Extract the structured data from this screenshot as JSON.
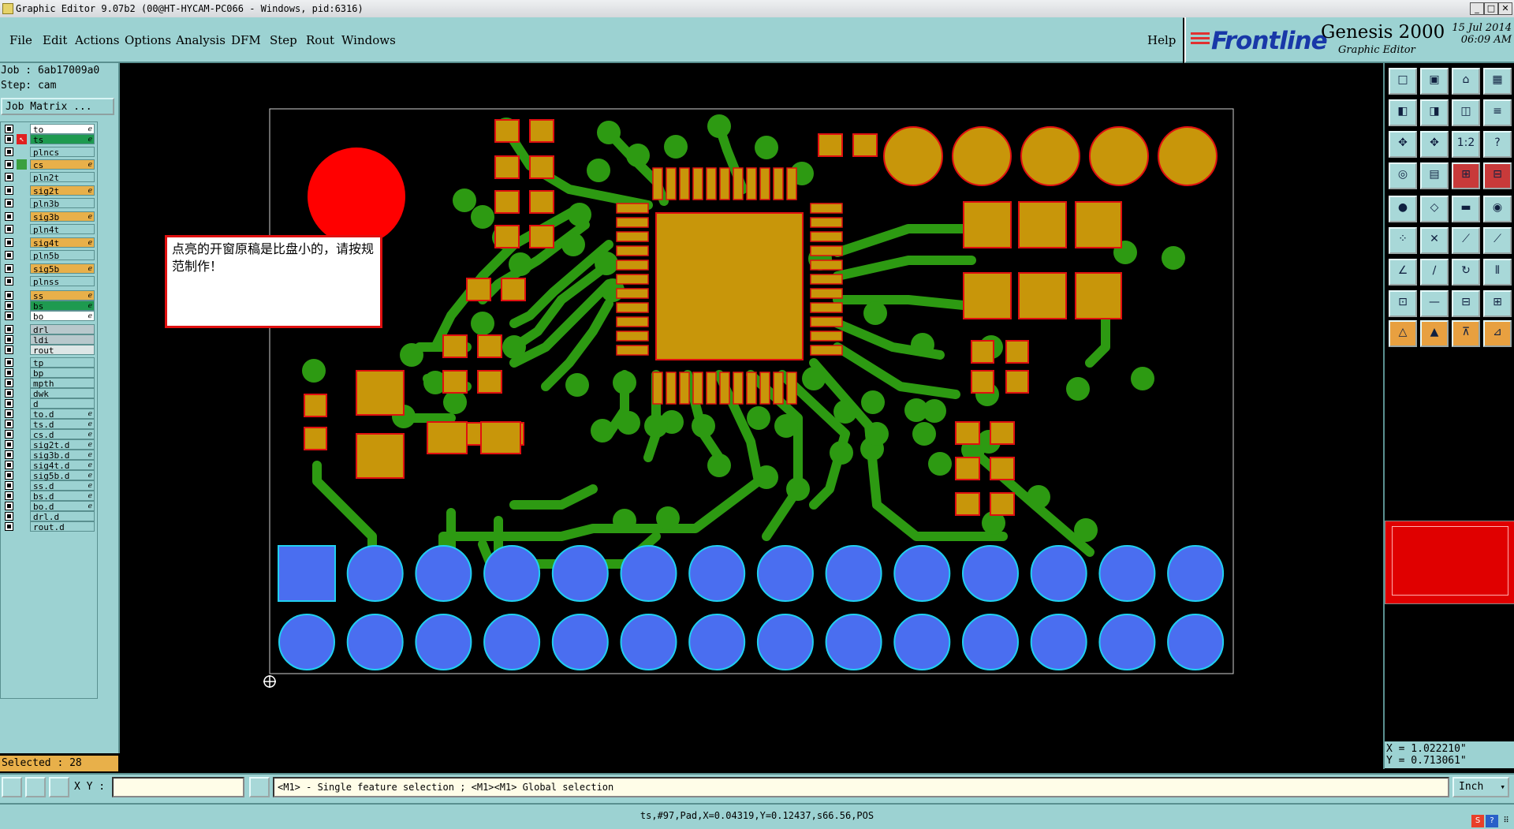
{
  "window": {
    "title": "Graphic Editor 9.07b2 (00@HT-HYCAM-PC066 - Windows, pid:6316)",
    "buttons": [
      "_",
      "□",
      "✕"
    ]
  },
  "menu": {
    "items": [
      "File",
      "Edit",
      "Actions",
      "Options",
      "Analysis",
      "DFM",
      "Step",
      "Rout",
      "Windows"
    ],
    "help": "Help"
  },
  "brand": {
    "logo": "Frontline",
    "product": "Genesis 2000",
    "subtitle": "Graphic Editor",
    "date": "15 Jul 2014",
    "time": "06:09 AM"
  },
  "left": {
    "job": "Job : 6ab17009a0",
    "step": "Step: cam",
    "job_matrix": "Job Matrix ...",
    "layers": [
      {
        "name": "to",
        "color": "#ffffff",
        "flag": "ℯ"
      },
      {
        "name": "ts",
        "color": "#1e9a50",
        "flag": "ℯ",
        "active": true
      },
      {
        "name": "plncs",
        "color": "#9cd2d2",
        "flag": ""
      },
      {
        "name": "cs",
        "color": "#e8b04a",
        "flag": "ℯ",
        "mark": "#3aa040"
      },
      {
        "name": "pln2t",
        "color": "#9cd2d2",
        "flag": ""
      },
      {
        "name": "sig2t",
        "color": "#e8b04a",
        "flag": "ℯ"
      },
      {
        "name": "pln3b",
        "color": "#9cd2d2",
        "flag": ""
      },
      {
        "name": "sig3b",
        "color": "#e8b04a",
        "flag": "ℯ"
      },
      {
        "name": "pln4t",
        "color": "#9cd2d2",
        "flag": ""
      },
      {
        "name": "sig4t",
        "color": "#e8b04a",
        "flag": "ℯ"
      },
      {
        "name": "pln5b",
        "color": "#9cd2d2",
        "flag": ""
      },
      {
        "name": "sig5b",
        "color": "#e8b04a",
        "flag": "ℯ"
      },
      {
        "name": "plnss",
        "color": "#9cd2d2",
        "flag": ""
      },
      {
        "name": "ss",
        "color": "#e8b04a",
        "flag": "ℯ"
      },
      {
        "name": "bs",
        "color": "#1e9a50",
        "flag": "ℯ"
      },
      {
        "name": "bo",
        "color": "#ffffff",
        "flag": "ℯ"
      },
      {
        "name": "drl",
        "color": "#b8c8cc",
        "flag": ""
      },
      {
        "name": "ldi",
        "color": "#b8c8cc",
        "flag": ""
      },
      {
        "name": "rout",
        "color": "#dde6e6",
        "flag": ""
      },
      {
        "name": "tp",
        "color": "#9cd2d2",
        "flag": ""
      },
      {
        "name": "bp",
        "color": "#9cd2d2",
        "flag": ""
      },
      {
        "name": "mpth",
        "color": "#9cd2d2",
        "flag": ""
      },
      {
        "name": "dwk",
        "color": "#9cd2d2",
        "flag": ""
      },
      {
        "name": "d",
        "color": "#9cd2d2",
        "flag": ""
      },
      {
        "name": "to.d",
        "color": "#9cd2d2",
        "flag": "ℯ"
      },
      {
        "name": "ts.d",
        "color": "#9cd2d2",
        "flag": "ℯ"
      },
      {
        "name": "cs.d",
        "color": "#9cd2d2",
        "flag": "ℯ"
      },
      {
        "name": "sig2t.d",
        "color": "#9cd2d2",
        "flag": "ℯ"
      },
      {
        "name": "sig3b.d",
        "color": "#9cd2d2",
        "flag": "ℯ"
      },
      {
        "name": "sig4t.d",
        "color": "#9cd2d2",
        "flag": "ℯ"
      },
      {
        "name": "sig5b.d",
        "color": "#9cd2d2",
        "flag": "ℯ"
      },
      {
        "name": "ss.d",
        "color": "#9cd2d2",
        "flag": "ℯ"
      },
      {
        "name": "bs.d",
        "color": "#9cd2d2",
        "flag": "ℯ"
      },
      {
        "name": "bo.d",
        "color": "#9cd2d2",
        "flag": "ℯ"
      },
      {
        "name": "drl.d",
        "color": "#9cd2d2",
        "flag": ""
      },
      {
        "name": "rout.d",
        "color": "#9cd2d2",
        "flag": ""
      }
    ],
    "selected": "Selected : 28"
  },
  "note": "点亮的开窗原稿是比盘小的，请按规范制作！",
  "coords": {
    "x": "X = 1.022210\"",
    "y": "Y = 0.713061\""
  },
  "bottom": {
    "xy_label": "X Y :",
    "xy_value": "",
    "hint": "<M1> - Single feature selection ; <M1><M1> Global selection",
    "units": "Inch"
  },
  "status": "ts,#97,Pad,X=0.04319,Y=0.12437,s66.56,POS",
  "colors": {
    "panel": "#9cd2d2",
    "copper": "#c8960a",
    "mask": "#2d9a12",
    "pad_outline": "#e01010",
    "bottom_pads": "#4a6ef0",
    "bottom_pad_outline": "#20d0f0",
    "fiducial": "#ff0000"
  }
}
